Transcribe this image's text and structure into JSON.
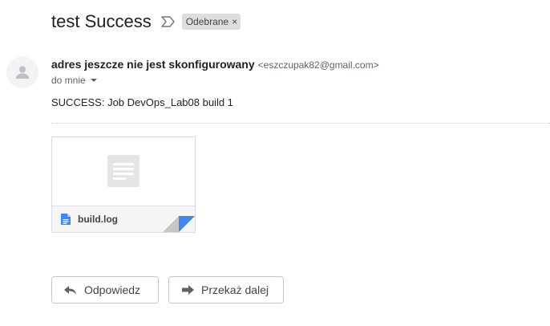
{
  "email": {
    "subject": "test Success",
    "label_chip": "Odebrane",
    "label_remove": "×",
    "sender_name": "adres jeszcze nie jest skonfigurowany",
    "sender_email": "<eszczupak82@gmail.com>",
    "to_text": "do mnie",
    "body": "SUCCESS: Job DevOps_Lab08 build 1"
  },
  "attachment": {
    "file_name": "build.log",
    "icon": "document-icon"
  },
  "actions": {
    "reply_label": "Odpowiedz",
    "forward_label": "Przekaż dalej"
  },
  "colors": {
    "attachment_corner": "#4285f4",
    "label_chip_bg": "#dddddd"
  }
}
